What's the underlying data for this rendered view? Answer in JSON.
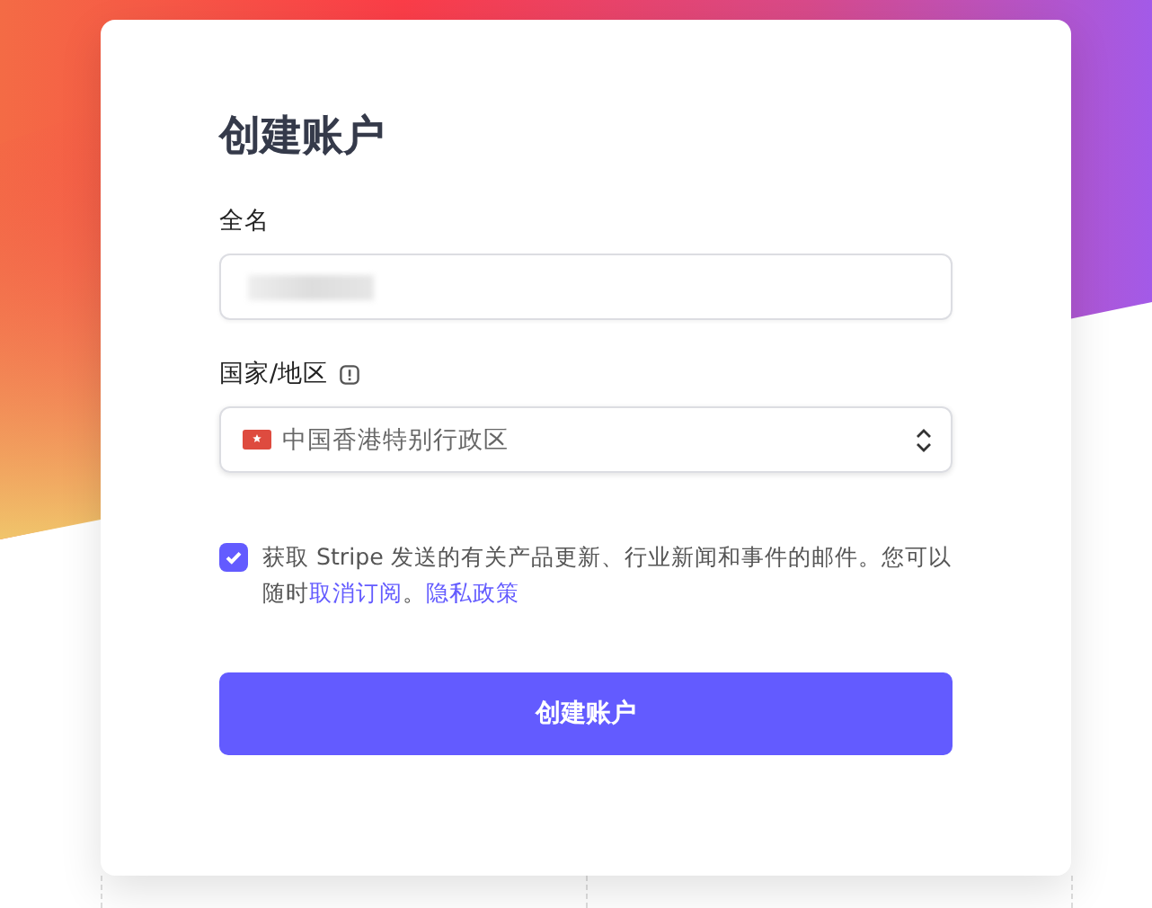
{
  "title": "创建账户",
  "fields": [
    {
      "kind": "text",
      "label": "全名",
      "info": false,
      "value_redacted": true
    },
    {
      "kind": "select",
      "label": "国家/地区",
      "info": true,
      "value": "中国香港特别行政区"
    }
  ],
  "consent": {
    "checked": true,
    "parts": [
      {
        "kind": "text",
        "text": "获取 Stripe 发送的有关产品更新、行业新闻和事件的邮件。您可以随时"
      },
      {
        "kind": "link",
        "text": "取消订阅"
      },
      {
        "kind": "text",
        "text": "。"
      },
      {
        "kind": "link",
        "text": "隐私政策"
      }
    ]
  },
  "submit": "创建账户"
}
